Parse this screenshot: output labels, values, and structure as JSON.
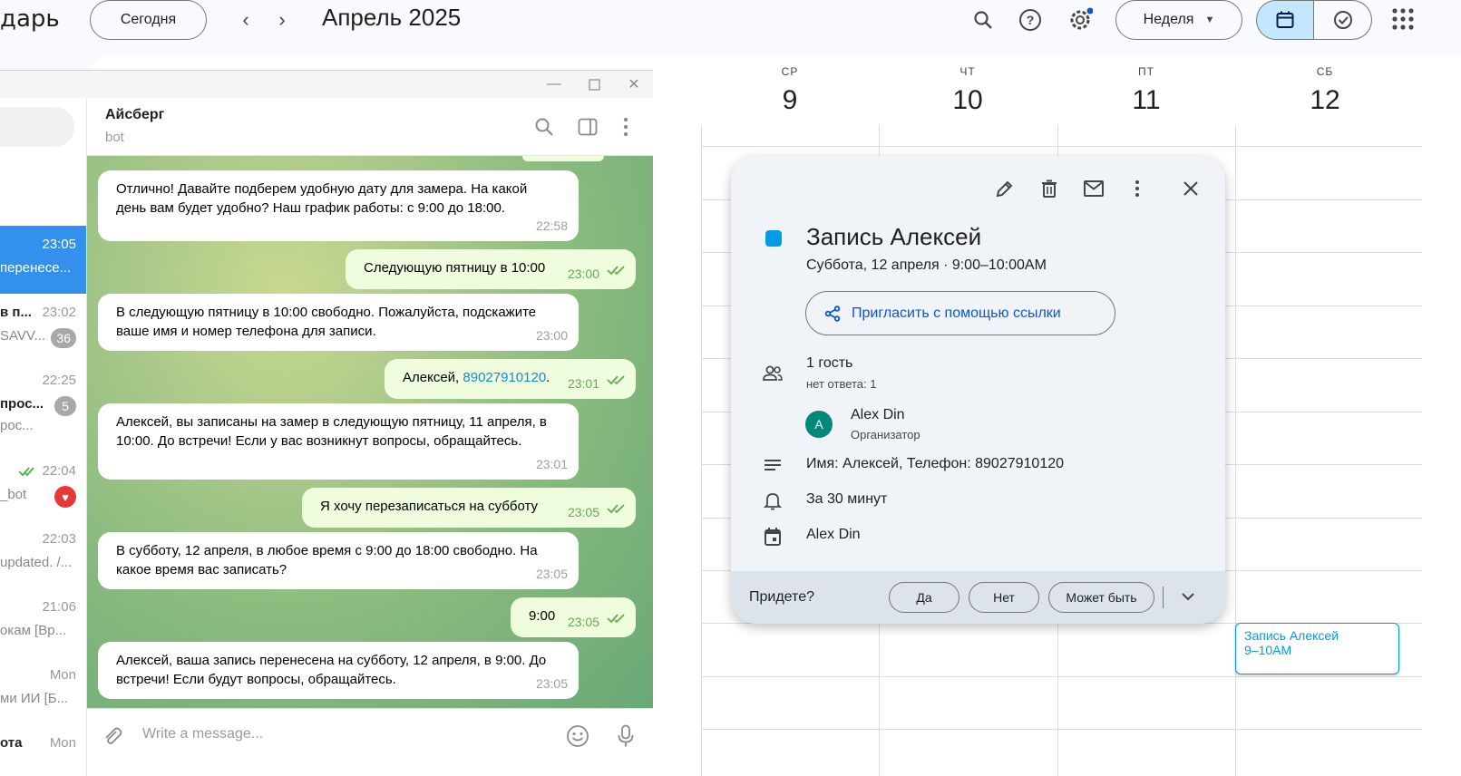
{
  "calendar": {
    "app_title": "дарь",
    "today_label": "Сегодня",
    "month": "Апрель 2025",
    "view_label": "Неделя",
    "days": [
      {
        "dow": "СР",
        "num": "9"
      },
      {
        "dow": "ЧТ",
        "num": "10"
      },
      {
        "dow": "ПТ",
        "num": "11"
      },
      {
        "dow": "СБ",
        "num": "12"
      }
    ],
    "chip": {
      "title": "Запись Алексей",
      "time": "9–10AM"
    },
    "accent": "#039be5"
  },
  "event": {
    "title": "Запись Алексей",
    "when": "Суббота, 12 апреля  ·  9:00–10:00AM",
    "invite_label": "Пригласить с помощью ссылки",
    "guests": "1 гость",
    "guests_status": "нет ответа: 1",
    "organizer_initial": "A",
    "organizer_name": "Alex Din",
    "organizer_role": "Организатор",
    "description": "Имя: Алексей, Телефон: 89027910120",
    "reminder": "За 30 минут",
    "calendar_owner": "Alex Din",
    "rsvp_label": "Придете?",
    "rsvp_yes": "Да",
    "rsvp_no": "Нет",
    "rsvp_maybe": "Может быть"
  },
  "telegram": {
    "chat_name": "Айсберг",
    "chat_status": "bot",
    "input_placeholder": "Write a message...",
    "sidebar": [
      {
        "time": "23:05",
        "name": "",
        "snippet": "перенесе...",
        "badge": "",
        "active": true
      },
      {
        "time": "23:02",
        "name": "в п...",
        "snippet": "SAVV...",
        "badge": "36",
        "active": false
      },
      {
        "time": "22:25",
        "name": "прос...",
        "snippet": "рос...",
        "badge": "5",
        "active": false
      },
      {
        "time": "22:04",
        "name": "",
        "snippet": "_bot",
        "badge": "",
        "active": false
      },
      {
        "time": "22:03",
        "name": "",
        "snippet": "updated. /...",
        "badge": "",
        "active": false
      },
      {
        "time": "21:06",
        "name": "",
        "snippet": "окам [Вр...",
        "badge": "",
        "active": false
      },
      {
        "time": "Mon",
        "name": "",
        "snippet": "ми ИИ [Б...",
        "badge": "",
        "active": false
      },
      {
        "time": "Mon",
        "name": "ота",
        "snippet": "",
        "badge": "",
        "active": false
      }
    ],
    "messages": [
      {
        "dir": "in",
        "text": "Отлично! Давайте подберем удобную дату для замера. На какой день вам будет удобно? Наш график работы: с 9:00 до 18:00.",
        "time": "22:58"
      },
      {
        "dir": "out",
        "text": "Следующую пятницу в 10:00",
        "time": "23:00"
      },
      {
        "dir": "in",
        "text": "В следующую пятницу в 10:00 свободно. Пожалуйста, подскажите ваше имя и номер телефона для записи.",
        "time": "23:00"
      },
      {
        "dir": "out",
        "text_prefix": "Алексей, ",
        "link": "89027910120",
        "text_suffix": ".",
        "time": "23:01"
      },
      {
        "dir": "in",
        "text": "Алексей, вы записаны на замер в следующую пятницу, 11 апреля, в 10:00. До встречи! Если у вас возникнут вопросы, обращайтесь.",
        "time": "23:01"
      },
      {
        "dir": "out",
        "text": "Я хочу перезаписаться на субботу",
        "time": "23:05"
      },
      {
        "dir": "in",
        "text": "В субботу, 12 апреля, в любое время с 9:00 до 18:00 свободно. На какое время вас записать?",
        "time": "23:05"
      },
      {
        "dir": "out",
        "text": "9:00",
        "time": "23:05"
      },
      {
        "dir": "in",
        "text": "Алексей, ваша запись перенесена на субботу, 12 апреля, в 9:00. До встречи! Если будут вопросы, обращайтесь.",
        "time": "23:05"
      }
    ]
  }
}
